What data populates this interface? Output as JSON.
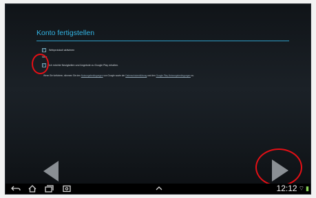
{
  "screen": {
    "title": "Konto fertigstellen",
    "options": [
      {
        "label": "Webprotokoll aktivieren",
        "checked": true
      },
      {
        "label": "Ich möchte Neuigkeiten und Angebote zu Google Play erhalten.",
        "checked": true
      }
    ],
    "sub_note": "Mehr",
    "terms": {
      "prefix": "Wenn Sie fortfahren, stimmen Sie den",
      "link1": "Nutzungsbedingungen",
      "middle": "von Google sowie der",
      "link2": "Datenschutzerklärung",
      "and": "und den",
      "link3": "Google Play-Nutzungsbedingungen",
      "suffix": "zu."
    }
  },
  "navbar": {
    "icons": [
      "back-icon",
      "home-icon",
      "recent-apps-icon",
      "screenshot-icon",
      "up-chevron-icon"
    ],
    "time": "12:12"
  },
  "colors": {
    "accent": "#33b5e5",
    "annotation": "#e50f15"
  }
}
